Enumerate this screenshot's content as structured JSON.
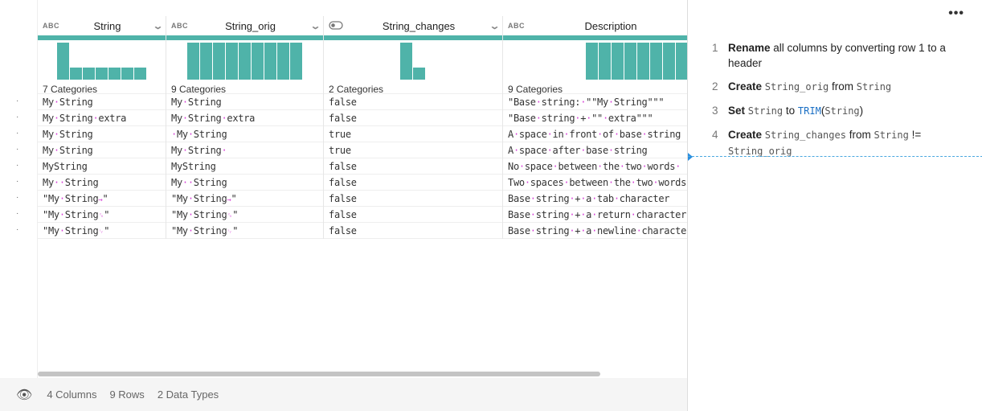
{
  "grid": {
    "columns": [
      {
        "type": "ABC",
        "name": "String",
        "categories": "7 Categories",
        "hist": [
          3,
          1,
          1,
          1,
          1,
          1,
          1
        ],
        "cells": [
          "My String",
          "My String extra",
          "My String",
          "My String",
          "MyString",
          "My  String",
          "\"My String\t\"",
          "\"My String\r\"",
          "\"My String\n\""
        ]
      },
      {
        "type": "ABC",
        "name": "String_orig",
        "categories": "9 Categories",
        "hist": [
          1,
          1,
          1,
          1,
          1,
          1,
          1,
          1,
          1
        ],
        "cells": [
          "My String",
          "My String extra",
          " My String",
          "My String ",
          "MyString",
          "My  String",
          "\"My String\t\"",
          "\"My String\r\"",
          "\"My String\n\""
        ]
      },
      {
        "type": "toggle",
        "name": "String_changes",
        "categories": "2 Categories",
        "hist": [
          3,
          1
        ],
        "cells": [
          "false",
          "false",
          "true",
          "true",
          "false",
          "false",
          "false",
          "false",
          "false"
        ]
      },
      {
        "type": "ABC",
        "name": "Description",
        "categories": "9 Categories",
        "hist": [
          1,
          1,
          1,
          1,
          1,
          1,
          1,
          1,
          1
        ],
        "cells": [
          "\"Base string: \"\"My String\"\"\"",
          "\"Base string + \"\" extra\"\"\"",
          "A space in front of base string",
          "A space after base string",
          "No space between the two words ",
          "Two spaces between the two words",
          "Base string + a tab character",
          "Base string + a return character",
          "Base string + a newline character"
        ]
      }
    ],
    "accent": "#4fb3a9"
  },
  "footer": {
    "columns": "4 Columns",
    "rows": "9 Rows",
    "types": "2 Data Types"
  },
  "recipe": {
    "steps": [
      {
        "num": "1",
        "verb": "Rename",
        "rest": " all columns by converting row 1 to a header"
      },
      {
        "num": "2",
        "verb": "Create",
        "a": "String_orig",
        "mid": " from ",
        "b": "String"
      },
      {
        "num": "3",
        "verb": "Set",
        "a": "String",
        "mid": " to ",
        "fn": "TRIM",
        "b": "String"
      },
      {
        "num": "4",
        "verb": "Create",
        "a": "String_changes",
        "mid": " from ",
        "b": "String",
        "op": " != ",
        "c": "String_orig"
      }
    ]
  }
}
